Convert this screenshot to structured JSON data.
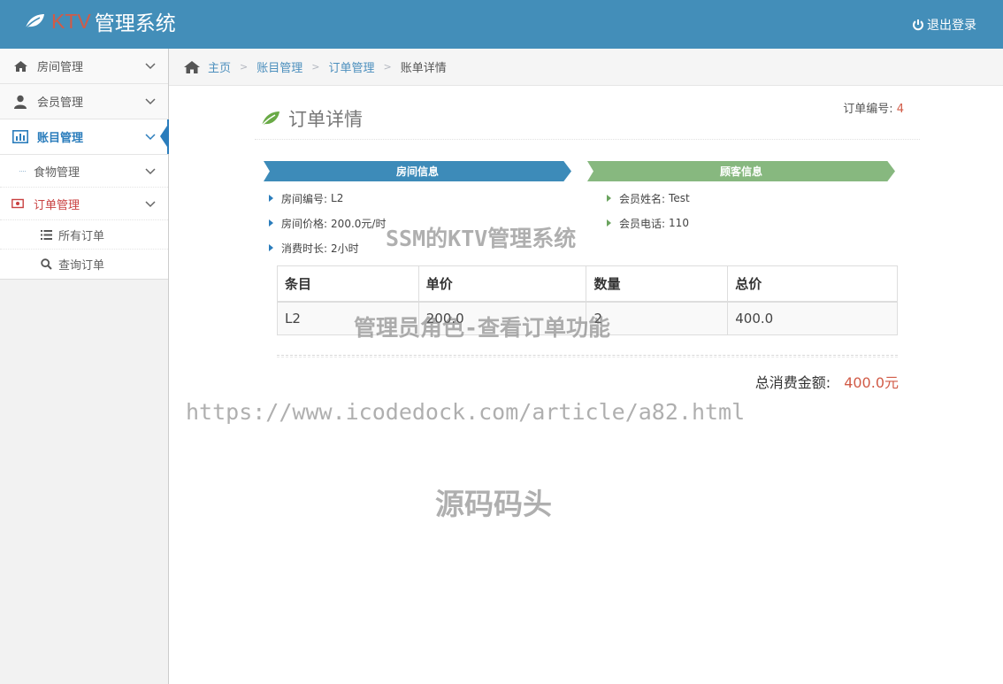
{
  "navbar": {
    "brand_ktv": "KTV",
    "brand_sys": "管理系统",
    "logout_label": "退出登录"
  },
  "sidebar": {
    "items": [
      {
        "label": "房间管理",
        "icon": "home-icon"
      },
      {
        "label": "会员管理",
        "icon": "user-icon"
      },
      {
        "label": "账目管理",
        "icon": "bar-chart-icon"
      }
    ],
    "sub_items": [
      {
        "label": "食物管理"
      },
      {
        "label": "订单管理"
      }
    ],
    "sub_sub_items": [
      {
        "label": "所有订单",
        "icon": "list-icon"
      },
      {
        "label": "查询订单",
        "icon": "search-icon"
      }
    ]
  },
  "breadcrumb": {
    "home": "主页",
    "level1": "账目管理",
    "level2": "订单管理",
    "current": "账单详情"
  },
  "page": {
    "title": "订单详情",
    "order_no_label": "订单编号:",
    "order_no_value": "4"
  },
  "room_info": {
    "title": "房间信息",
    "rows": [
      {
        "key": "房间编号:",
        "value": "L2"
      },
      {
        "key": "房间价格:",
        "value": "200.0元/时"
      },
      {
        "key": "消费时长:",
        "value": "2小时"
      }
    ]
  },
  "customer_info": {
    "title": "顾客信息",
    "rows": [
      {
        "key": "会员姓名:",
        "value": "Test"
      },
      {
        "key": "会员电话:",
        "value": "110"
      }
    ]
  },
  "table": {
    "headers": [
      "条目",
      "单价",
      "数量",
      "总价"
    ],
    "rows": [
      [
        "L2",
        "200.0",
        "2",
        "400.0"
      ]
    ]
  },
  "total": {
    "label": "总消费金额:",
    "value": "400.0元"
  },
  "watermarks": {
    "w1": "SSM的KTV管理系统",
    "w2": "管理员角色-查看订单功能",
    "w3": "https://www.icodedock.com/article/a82.html",
    "w4": "源码码头"
  },
  "colors": {
    "navbar": "#438eb9",
    "accent_red": "#d15b47",
    "ribbon_blue": "#3d8bb9",
    "ribbon_green": "#87b87f"
  }
}
